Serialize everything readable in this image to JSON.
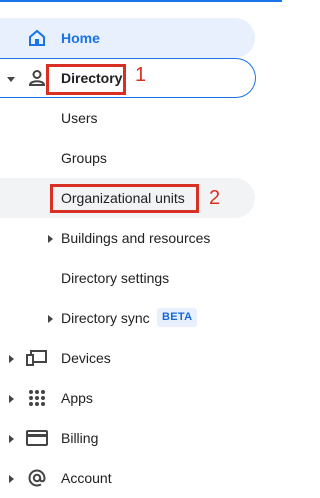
{
  "nav": {
    "home": "Home",
    "directory": "Directory",
    "users": "Users",
    "groups": "Groups",
    "org_units": "Organizational units",
    "buildings": "Buildings and resources",
    "directory_settings": "Directory settings",
    "directory_sync": "Directory sync",
    "directory_sync_badge": "BETA",
    "devices": "Devices",
    "apps": "Apps",
    "billing": "Billing",
    "account": "Account"
  },
  "annotations": {
    "callout_1": "1",
    "callout_2": "2"
  },
  "colors": {
    "accent": "#1a73e8",
    "annotation": "#d93025",
    "selected_bg": "#e8f0fe"
  },
  "icons": [
    "home-icon",
    "person-icon",
    "devices-icon",
    "apps-grid-icon",
    "billing-card-icon",
    "account-at-icon"
  ]
}
